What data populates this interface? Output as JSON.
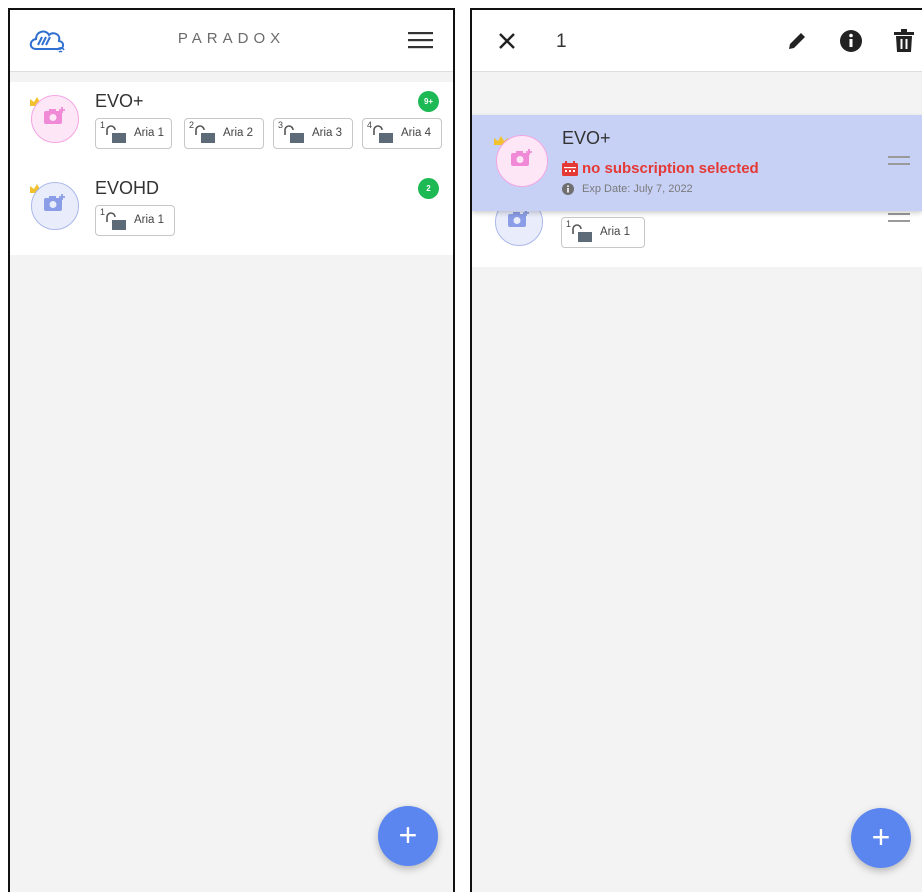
{
  "left_screen": {
    "header": {
      "brand": "PARADOX",
      "logo_icon": "cloud-wifi-logo",
      "menu_icon": "hamburger-menu-icon"
    },
    "devices": [
      {
        "name": "EVO+",
        "badge": "9+",
        "areas": [
          {
            "num": "1",
            "label": "Aria 1"
          },
          {
            "num": "2",
            "label": "Aria 2"
          },
          {
            "num": "3",
            "label": "Aria 3"
          },
          {
            "num": "4",
            "label": "Aria 4"
          }
        ]
      },
      {
        "name": "EVOHD",
        "badge": "2",
        "areas": [
          {
            "num": "1",
            "label": "Aria 1"
          }
        ]
      }
    ],
    "fab_label": "+"
  },
  "right_screen": {
    "toolbar": {
      "selected_count": "1",
      "icons": [
        "close-icon",
        "edit-icon",
        "info-icon",
        "trash-icon"
      ]
    },
    "selected_device": {
      "name": "EVO+",
      "subscription_status": "no subscription selected",
      "exp_date": "Exp Date: July 7, 2022"
    },
    "second_device": {
      "areas": [
        {
          "num": "1",
          "label": "Aria 1"
        }
      ]
    },
    "fab_label": "+"
  },
  "colors": {
    "accent_blue": "#5b86f0",
    "badge_green": "#1db954",
    "alert_red": "#e53935",
    "selection": "#c7d1f6",
    "avatar_pink": "#f08ad6",
    "avatar_blue": "#8a9de6",
    "crown": "#f2c12e"
  }
}
